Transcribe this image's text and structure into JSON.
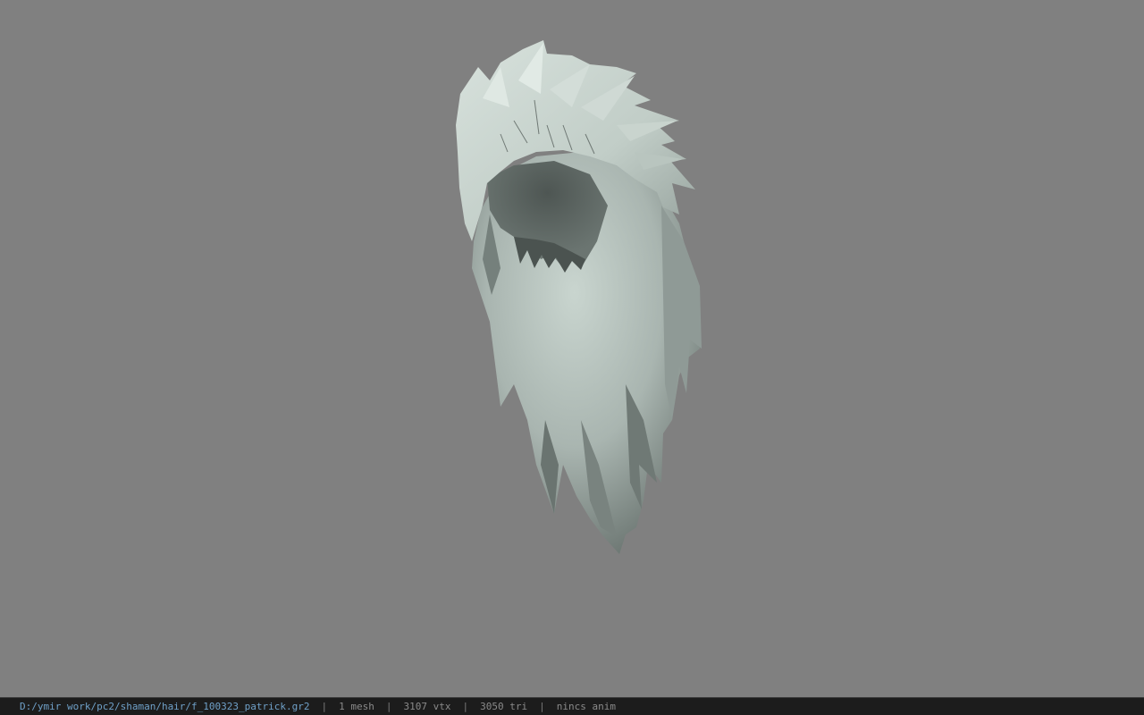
{
  "viewport": {
    "background_color": "#808080",
    "model_color": "#c6d2cc",
    "model_shadow_color": "#5c6461"
  },
  "statusbar": {
    "file_path": "D:/ymir work/pc2/shaman/hair/f_100323_patrick.gr2",
    "mesh_count": "1 mesh",
    "vertex_count": "3107 vtx",
    "triangle_count": "3050 tri",
    "anim_status": "nincs anim",
    "separator": "|"
  }
}
